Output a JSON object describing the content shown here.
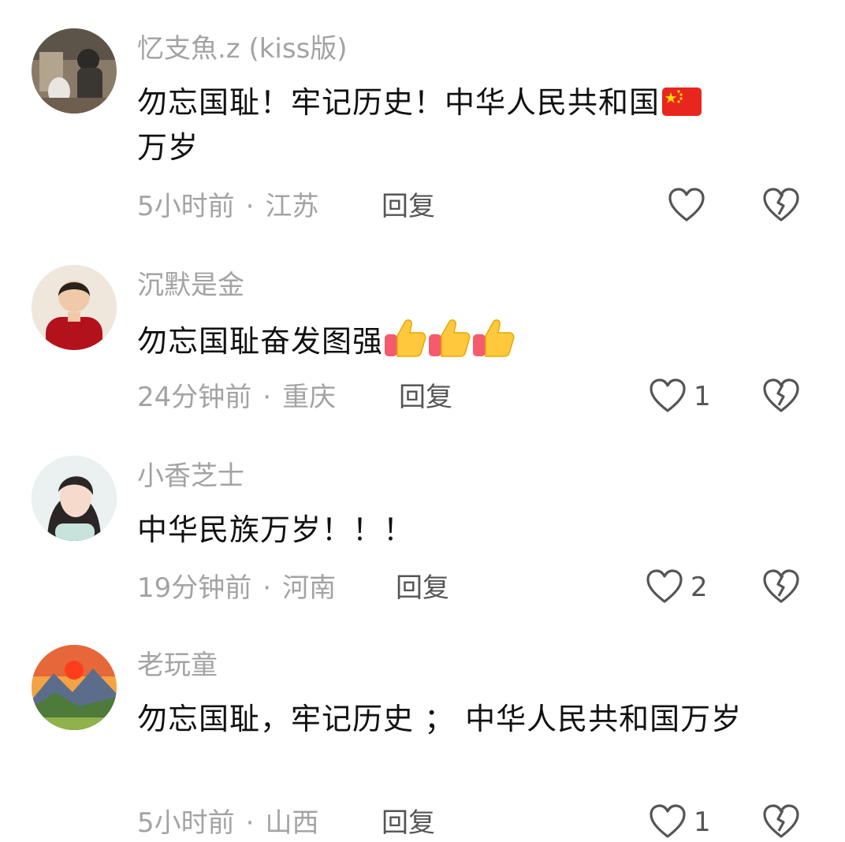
{
  "comments": [
    {
      "username": "忆支魚.z (kiss版)",
      "text": "勿忘国耻！牢记历史！中华人民共和国",
      "text_emoji": "china-flag",
      "text_tail": "万岁",
      "time": "5小时前",
      "separator": "·",
      "location": "江苏",
      "reply_label": "回复",
      "like_count": ""
    },
    {
      "username": "沉默是金",
      "text": "勿忘国耻奋发图强",
      "text_emoji": "thumbs-up x3",
      "text_tail": "",
      "time": "24分钟前",
      "separator": "·",
      "location": "重庆",
      "reply_label": "回复",
      "like_count": "1"
    },
    {
      "username": "小香芝士",
      "text": "中华民族万岁！！！",
      "text_emoji": "",
      "text_tail": "",
      "time": "19分钟前",
      "separator": "·",
      "location": "河南",
      "reply_label": "回复",
      "like_count": "2"
    },
    {
      "username": "老玩童",
      "text": "勿忘国耻，牢记历史 ； 中华人民共和国万岁",
      "text_emoji": "",
      "text_tail": "",
      "time": "5小时前",
      "separator": "·",
      "location": "山西",
      "reply_label": "回复",
      "like_count": "1"
    }
  ],
  "icons": {
    "like": "heart-outline-icon",
    "dislike": "broken-heart-icon"
  },
  "colors": {
    "secondary_text": "#a3a3a3",
    "primary_text": "#111111",
    "icon_stroke": "#555555"
  }
}
